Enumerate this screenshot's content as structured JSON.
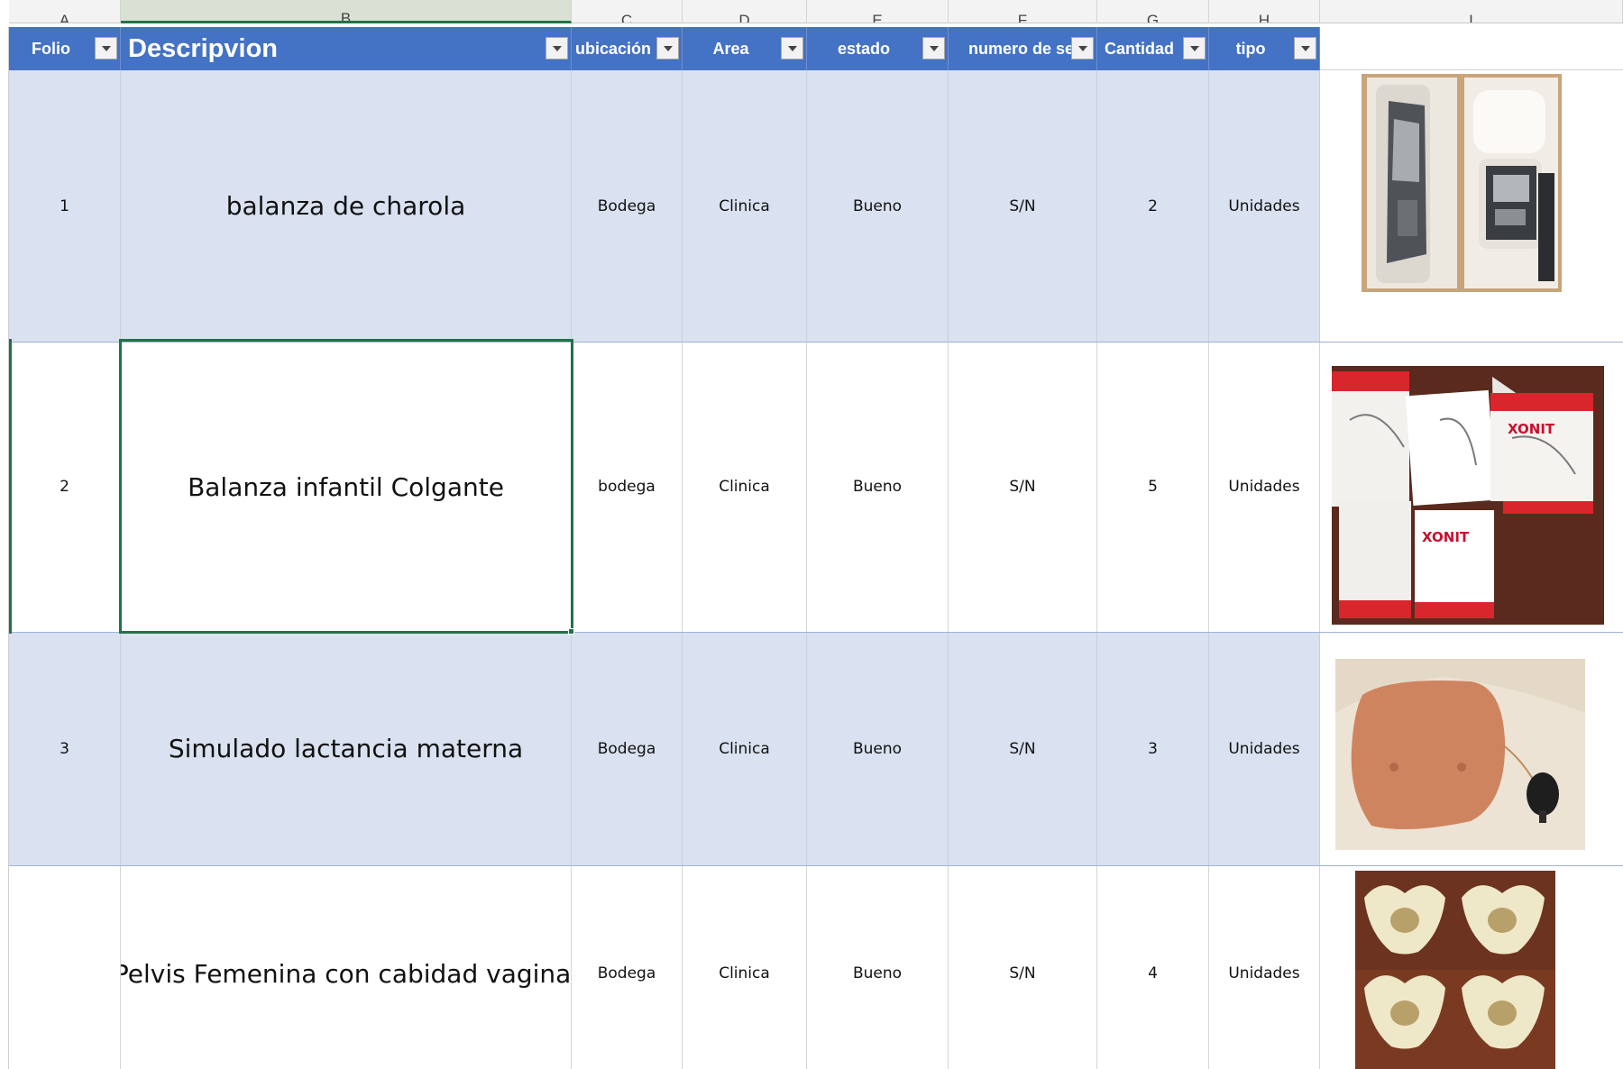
{
  "column_letters": [
    "A",
    "B",
    "C",
    "D",
    "E",
    "F",
    "G",
    "H",
    "I"
  ],
  "selected_column": "B",
  "headers": {
    "folio": "Folio",
    "descripcion": "Descripvion",
    "ubicacion": "ubicación",
    "area": "Area",
    "estado": "estado",
    "numero_serie": "numero de serie",
    "cantidad": "Cantidad",
    "tipo": "tipo"
  },
  "rows": [
    {
      "folio": "1",
      "descripcion": "balanza de charola",
      "ubicacion": "Bodega",
      "area": "Clinica",
      "estado": "Bueno",
      "numero_serie": "S/N",
      "cantidad": "2",
      "tipo": "Unidades",
      "image": "boxed-tray-scale-photo"
    },
    {
      "folio": "2",
      "descripcion": "Balanza infantil Colgante",
      "ubicacion": "bodega",
      "area": "Clinica",
      "estado": "Bueno",
      "numero_serie": "S/N",
      "cantidad": "5",
      "tipo": "Unidades",
      "image": "xonit-hanging-scale-boxes-photo"
    },
    {
      "folio": "3",
      "descripcion": "Simulado lactancia materna",
      "ubicacion": "Bodega",
      "area": "Clinica",
      "estado": "Bueno",
      "numero_serie": "S/N",
      "cantidad": "3",
      "tipo": "Unidades",
      "image": "breastfeeding-simulator-photo"
    },
    {
      "folio": "",
      "descripcion": "Pelvis Femenina con cabidad vaginal",
      "ubicacion": "Bodega",
      "area": "Clinica",
      "estado": "Bueno",
      "numero_serie": "S/N",
      "cantidad": "4",
      "tipo": "Unidades",
      "image": "female-pelvis-models-photo"
    }
  ],
  "photo_text": {
    "brand": "XONIT"
  },
  "colors": {
    "header_blue": "#4472c4",
    "band_row": "#dae1f0",
    "selection_green": "#217346"
  }
}
